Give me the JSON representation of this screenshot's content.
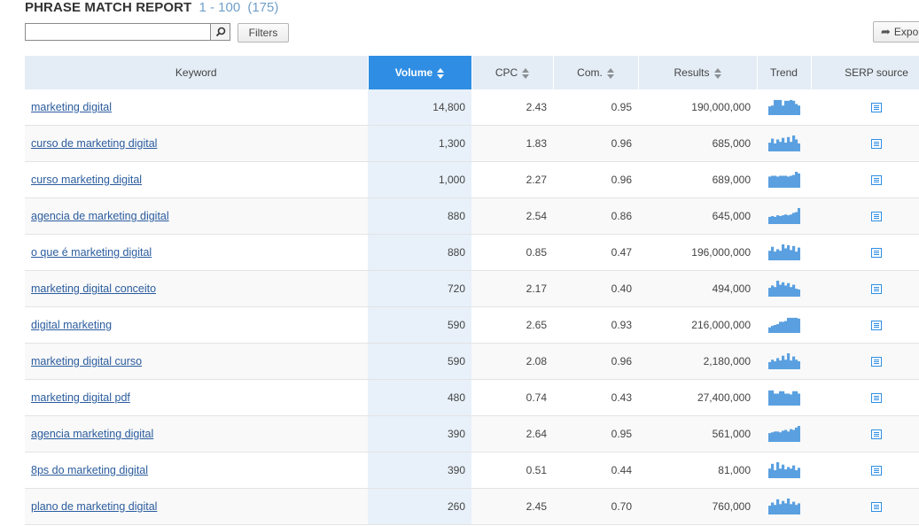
{
  "report": {
    "title": "PHRASE MATCH REPORT",
    "range": "1 - 100",
    "total": "(175)"
  },
  "toolbar": {
    "search_value": "",
    "search_placeholder": "",
    "search_icon": "search-icon",
    "filters_label": "Filters",
    "export_label": "Export",
    "export_icon": "share-arrow-icon"
  },
  "table": {
    "columns": [
      {
        "key": "keyword",
        "label": "Keyword",
        "sortable": false
      },
      {
        "key": "volume",
        "label": "Volume",
        "sortable": true,
        "active": true
      },
      {
        "key": "cpc",
        "label": "CPC",
        "sortable": true
      },
      {
        "key": "com",
        "label": "Com.",
        "sortable": true
      },
      {
        "key": "results",
        "label": "Results",
        "sortable": true
      },
      {
        "key": "trend",
        "label": "Trend",
        "sortable": false
      },
      {
        "key": "serp",
        "label": "SERP source",
        "sortable": false
      }
    ],
    "rows": [
      {
        "keyword": "marketing digital",
        "volume": "14,800",
        "cpc": "2.43",
        "com": "0.95",
        "results": "190,000,000",
        "trend": [
          0.55,
          0.6,
          0.95,
          0.95,
          0.95,
          0.6,
          0.9,
          0.9,
          0.95,
          0.9,
          0.7,
          0.6
        ]
      },
      {
        "keyword": "curso de marketing digital",
        "volume": "1,300",
        "cpc": "1.83",
        "com": "0.96",
        "results": "685,000",
        "trend": [
          0.55,
          0.8,
          0.5,
          0.75,
          0.6,
          0.85,
          0.55,
          0.9,
          0.6,
          1.0,
          0.75,
          0.5
        ]
      },
      {
        "keyword": "curso marketing digital",
        "volume": "1,000",
        "cpc": "2.27",
        "com": "0.96",
        "results": "689,000",
        "trend": [
          0.7,
          0.75,
          0.75,
          0.7,
          0.75,
          0.75,
          0.75,
          0.7,
          0.75,
          0.8,
          1.0,
          0.9
        ]
      },
      {
        "keyword": "agencia de marketing digital",
        "volume": "880",
        "cpc": "2.54",
        "com": "0.86",
        "results": "645,000",
        "trend": [
          0.45,
          0.5,
          0.45,
          0.55,
          0.5,
          0.55,
          0.6,
          0.55,
          0.6,
          0.7,
          0.75,
          1.0
        ]
      },
      {
        "keyword": "o que é marketing digital",
        "volume": "880",
        "cpc": "0.85",
        "com": "0.47",
        "results": "196,000,000",
        "trend": [
          0.6,
          0.85,
          0.55,
          0.7,
          0.6,
          1.0,
          0.75,
          0.95,
          0.65,
          0.9,
          0.55,
          0.8
        ]
      },
      {
        "keyword": "marketing digital conceito",
        "volume": "720",
        "cpc": "2.17",
        "com": "0.40",
        "results": "494,000",
        "trend": [
          0.55,
          0.7,
          0.6,
          1.0,
          0.75,
          0.9,
          0.7,
          0.85,
          0.6,
          0.75,
          0.5,
          0.45
        ]
      },
      {
        "keyword": "digital marketing",
        "volume": "590",
        "cpc": "2.65",
        "com": "0.93",
        "results": "216,000,000",
        "trend": [
          0.35,
          0.45,
          0.5,
          0.55,
          0.7,
          0.7,
          0.75,
          0.95,
          0.95,
          0.95,
          0.95,
          0.9
        ]
      },
      {
        "keyword": "marketing digital curso",
        "volume": "590",
        "cpc": "2.08",
        "com": "0.96",
        "results": "2,180,000",
        "trend": [
          0.45,
          0.6,
          0.5,
          0.7,
          0.55,
          0.85,
          0.6,
          1.0,
          0.55,
          0.8,
          0.6,
          0.5
        ]
      },
      {
        "keyword": "marketing digital pdf",
        "volume": "480",
        "cpc": "0.74",
        "com": "0.43",
        "results": "27,400,000",
        "trend": [
          0.95,
          0.95,
          0.75,
          0.75,
          0.9,
          0.9,
          0.75,
          0.75,
          0.7,
          0.9,
          0.9,
          0.75
        ]
      },
      {
        "keyword": "agencia marketing digital",
        "volume": "390",
        "cpc": "2.64",
        "com": "0.95",
        "results": "561,000",
        "trend": [
          0.55,
          0.6,
          0.65,
          0.65,
          0.6,
          0.7,
          0.75,
          0.65,
          0.8,
          0.75,
          0.9,
          1.0
        ]
      },
      {
        "keyword": "8ps do marketing digital",
        "volume": "390",
        "cpc": "0.51",
        "com": "0.44",
        "results": "81,000",
        "trend": [
          0.6,
          0.9,
          0.5,
          1.0,
          0.6,
          0.85,
          0.55,
          0.7,
          0.6,
          0.8,
          0.5,
          0.65
        ]
      },
      {
        "keyword": "plano de marketing digital",
        "volume": "260",
        "cpc": "2.45",
        "com": "0.70",
        "results": "760,000",
        "trend": [
          0.55,
          0.75,
          0.6,
          0.95,
          0.65,
          0.85,
          0.7,
          1.0,
          0.65,
          0.8,
          0.6,
          0.7
        ]
      }
    ]
  },
  "colors": {
    "accent": "#2f8ee3",
    "header_bg": "#e4edf6",
    "link": "#2b5c9e",
    "trend_bar": "#5aa0e0",
    "volume_col_bg": "#e8f1fa"
  }
}
